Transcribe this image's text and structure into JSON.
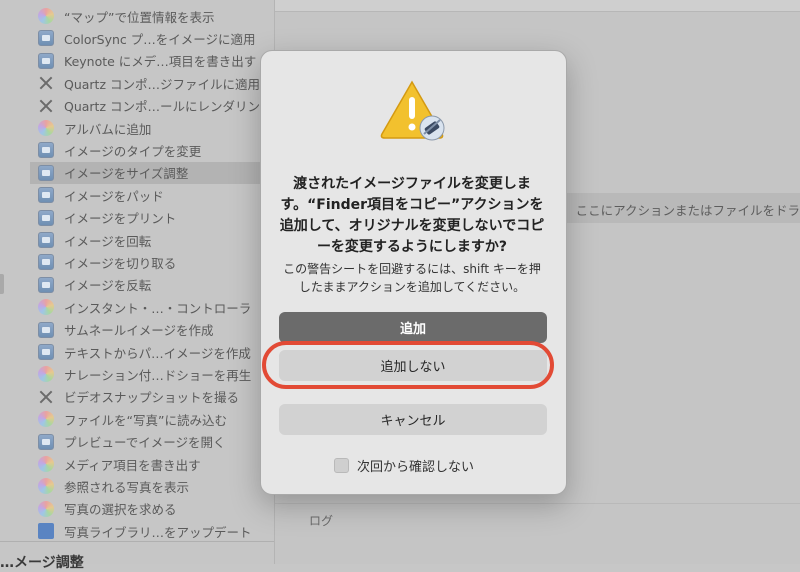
{
  "sidebar": {
    "items": [
      {
        "label": "“マップ”で位置情報を表示",
        "icon": "photos-icon"
      },
      {
        "label": "ColorSync プ…をイメージに適用",
        "icon": "preview-icon"
      },
      {
        "label": "Keynote にメデ…項目を書き出す",
        "icon": "preview-icon"
      },
      {
        "label": "Quartz コンポ…ジファイルに適用",
        "icon": "tools-icon"
      },
      {
        "label": "Quartz コンポ…ールにレンダリング",
        "icon": "tools-icon"
      },
      {
        "label": "アルバムに追加",
        "icon": "photos-icon"
      },
      {
        "label": "イメージのタイプを変更",
        "icon": "preview-icon"
      },
      {
        "label": "イメージをサイズ調整",
        "icon": "preview-icon",
        "selected": true
      },
      {
        "label": "イメージをパッド",
        "icon": "preview-icon"
      },
      {
        "label": "イメージをプリント",
        "icon": "preview-icon"
      },
      {
        "label": "イメージを回転",
        "icon": "preview-icon"
      },
      {
        "label": "イメージを切り取る",
        "icon": "preview-icon"
      },
      {
        "label": "イメージを反転",
        "icon": "preview-icon"
      },
      {
        "label": "インスタント・…・コントローラ",
        "icon": "photos-icon"
      },
      {
        "label": "サムネールイメージを作成",
        "icon": "preview-icon"
      },
      {
        "label": "テキストからパ…イメージを作成",
        "icon": "preview-icon"
      },
      {
        "label": "ナレーション付…ドショーを再生",
        "icon": "photos-icon"
      },
      {
        "label": "ビデオスナップショットを撮る",
        "icon": "tools-icon"
      },
      {
        "label": "ファイルを“写真”に読み込む",
        "icon": "photos-icon"
      },
      {
        "label": "プレビューでイメージを開く",
        "icon": "preview-icon"
      },
      {
        "label": "メディア項目を書き出す",
        "icon": "photos-icon"
      },
      {
        "label": "参照される写真を表示",
        "icon": "photos-icon"
      },
      {
        "label": "写真の選択を求める",
        "icon": "photos-icon"
      },
      {
        "label": "写真ライブラリ…をアップデート",
        "icon": "keynote-icon"
      }
    ],
    "bottom_heading": "…メージ調整"
  },
  "main": {
    "drop_hint": "ここにアクションまたはファイルをドラ",
    "log_label": "ログ"
  },
  "dialog": {
    "title": "渡されたイメージファイルを変更します。“Finder項目をコピー”アクションを追加して、オリジナルを変更しないでコピーを変更するようにしますか?",
    "description": "この警告シートを回避するには、shift キーを押したままアクションを追加してください。",
    "add_label": "追加",
    "dont_add_label": "追加しない",
    "cancel_label": "キャンセル",
    "checkbox_label": "次回から確認しない",
    "checkbox_checked": false,
    "icon": "warning-automator-icon",
    "highlight_color": "#e24a35"
  }
}
